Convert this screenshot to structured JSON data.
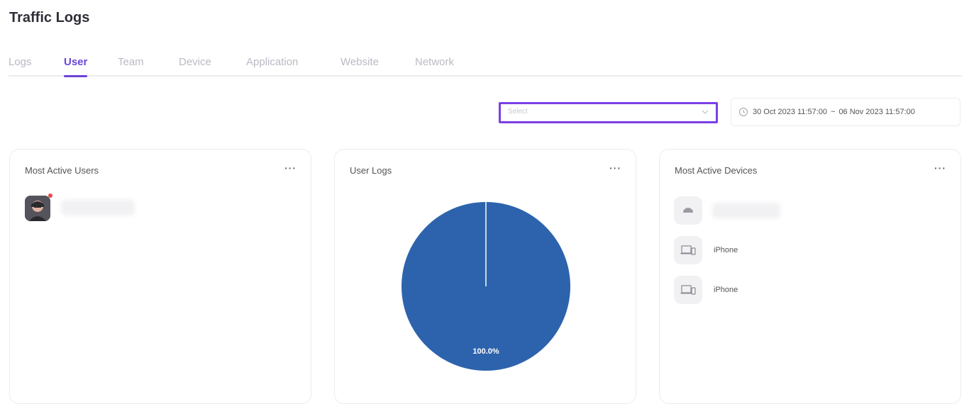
{
  "header": {
    "title": "Traffic Logs"
  },
  "tabs": [
    {
      "label": "Logs",
      "active": false
    },
    {
      "label": "User",
      "active": true
    },
    {
      "label": "Team",
      "active": false
    },
    {
      "label": "Device",
      "active": false
    },
    {
      "label": "Application",
      "active": false
    },
    {
      "label": "Website",
      "active": false
    },
    {
      "label": "Network",
      "active": false
    }
  ],
  "filters": {
    "select_placeholder": "Select",
    "date_start": "30 Oct 2023 11:57:00",
    "date_separator": "~",
    "date_end": "06 Nov 2023 11:57:00"
  },
  "cards": {
    "active_users": {
      "title": "Most Active Users",
      "more": "···"
    },
    "user_logs": {
      "title": "User Logs",
      "more": "···"
    },
    "active_devices": {
      "title": "Most Active Devices",
      "more": "···",
      "devices": [
        {
          "name": "",
          "icon": "cloud-icon"
        },
        {
          "name": "iPhone",
          "icon": "devices-icon"
        },
        {
          "name": "iPhone",
          "icon": "devices-icon"
        }
      ]
    }
  },
  "colors": {
    "accent": "#6a45d8",
    "pie": "#2d63ad"
  },
  "chart_data": {
    "type": "pie",
    "slices": [
      {
        "label": "",
        "value": 100.0,
        "display": "100.0%"
      }
    ]
  }
}
